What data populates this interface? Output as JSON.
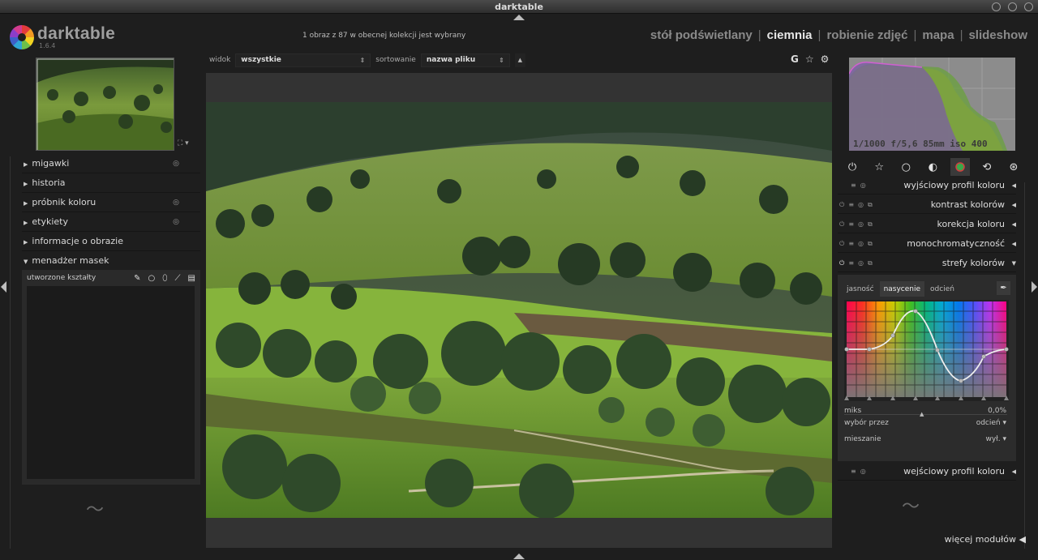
{
  "window": {
    "title": "darktable"
  },
  "app": {
    "name": "darktable",
    "version": "1.6.4"
  },
  "header": {
    "collection_info": "1 obraz z 87 w obecnej kolekcji jest wybrany",
    "views": [
      {
        "label": "stół podświetlany"
      },
      {
        "label": "ciemnia"
      },
      {
        "label": "robienie zdjęć"
      },
      {
        "label": "mapa"
      },
      {
        "label": "slideshow"
      }
    ],
    "active_view": "ciemnia"
  },
  "toolbar": {
    "view_label": "widok",
    "view_value": "wszystkie",
    "sort_label": "sortowanie",
    "sort_value": "nazwa pliku",
    "right_icons": {
      "g": "G",
      "star": "☆",
      "gear": "⚙"
    }
  },
  "left_panel": {
    "modules": [
      {
        "label": "migawki",
        "expanded": false
      },
      {
        "label": "historia",
        "expanded": false
      },
      {
        "label": "próbnik koloru",
        "expanded": false
      },
      {
        "label": "etykiety",
        "expanded": false
      },
      {
        "label": "informacje o obrazie",
        "expanded": false
      },
      {
        "label": "menadżer masek",
        "expanded": true
      }
    ],
    "mask_manager": {
      "created_shapes_label": "utworzone kształty"
    }
  },
  "right_panel": {
    "histogram_info": "1/1000 f/5,6 85mm iso 400",
    "modules": [
      {
        "label": "wyjściowy profil koloru",
        "arrow": "◀"
      },
      {
        "label": "kontrast kolorów",
        "arrow": "◀"
      },
      {
        "label": "korekcja koloru",
        "arrow": "◀"
      },
      {
        "label": "monochromatyczność",
        "arrow": "◀"
      },
      {
        "label": "strefy kolorów",
        "arrow": "▼"
      }
    ],
    "color_zones": {
      "tabs": [
        "jasność",
        "nasycenie",
        "odcień"
      ],
      "active_tab": "nasycenie",
      "mix_label": "miks",
      "mix_value": "0,0%",
      "select_by_label": "wybór przez",
      "select_by_value": "odcień",
      "blend_label": "mieszanie",
      "blend_value": "wył."
    },
    "input_profile_label": "wejściowy profil koloru",
    "more_modules_label": "więcej modułów"
  },
  "colors": {
    "accent": "#e6e6e6",
    "panel": "#2c2c2c",
    "background": "#1e1e1e"
  }
}
